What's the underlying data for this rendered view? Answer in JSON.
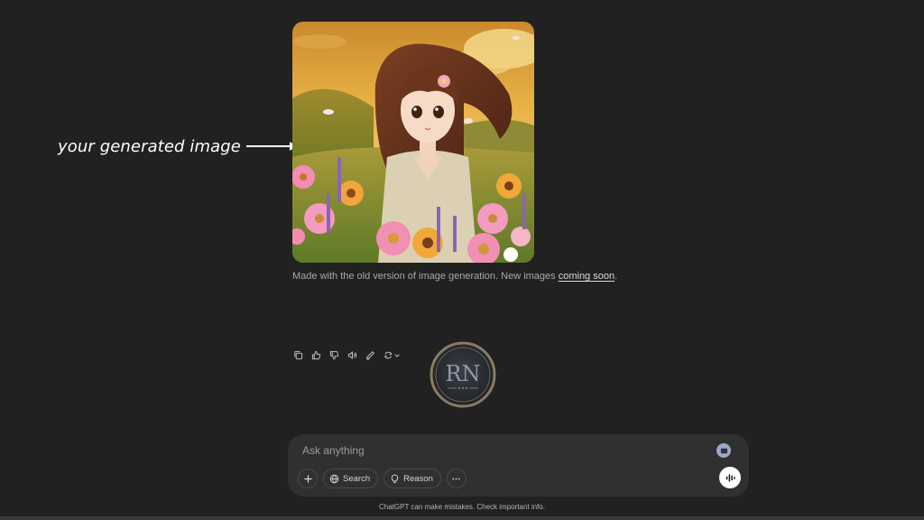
{
  "annotation": {
    "text": "your generated image"
  },
  "image_caption": {
    "text": "Made with the old version of image generation. New images ",
    "link": "coming soon",
    "end": "."
  },
  "message_actions": [
    {
      "name": "copy-button",
      "icon": "copy-icon"
    },
    {
      "name": "thumbs-up-button",
      "icon": "thumbs-up-icon"
    },
    {
      "name": "thumbs-down-button",
      "icon": "thumbs-down-icon"
    },
    {
      "name": "read-aloud-button",
      "icon": "speaker-icon"
    },
    {
      "name": "edit-image-button",
      "icon": "pen-icon"
    },
    {
      "name": "regenerate-button",
      "icon": "refresh-icon"
    }
  ],
  "watermark": {
    "letters": "RN"
  },
  "composer": {
    "placeholder": "Ask anything",
    "tools": {
      "search_label": "Search",
      "reason_label": "Reason"
    }
  },
  "disclaimer": "ChatGPT can make mistakes. Check important info.",
  "colors": {
    "background": "#212121",
    "composer": "#303030",
    "voice_button": "#ffffff"
  }
}
